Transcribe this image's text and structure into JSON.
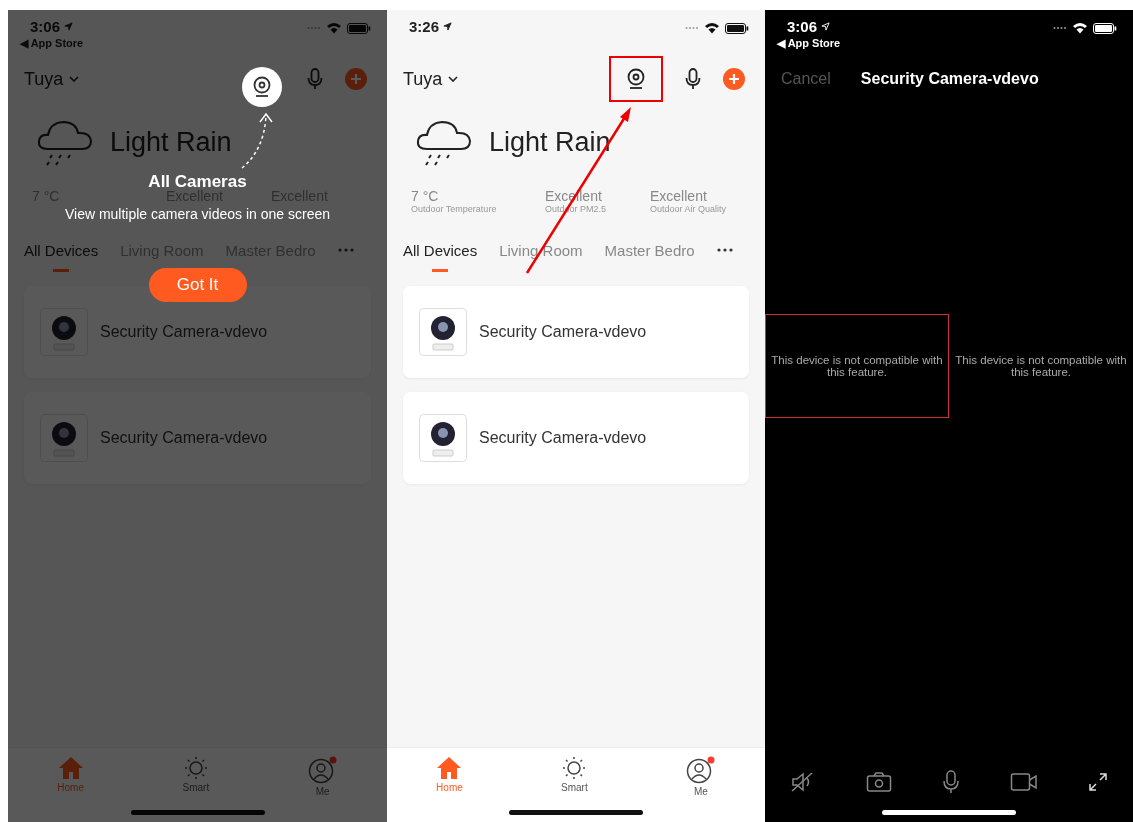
{
  "screens": [
    {
      "kind": "home",
      "dimmed": true,
      "status": {
        "time": "3:06",
        "back": "◀ App Store"
      },
      "home": "Tuya",
      "weather": "Light Rain",
      "stats": [
        {
          "value": "7 °C"
        },
        {
          "value": "Excellent"
        },
        {
          "value": "Excellent"
        }
      ],
      "tabs": [
        {
          "label": "All Devices",
          "selected": true
        },
        {
          "label": "Living Room",
          "selected": false
        },
        {
          "label": "Master Bedro",
          "selected": false
        }
      ],
      "devices": [
        {
          "name": "Security Camera-vdevo"
        },
        {
          "name": "Security Camera-vdevo"
        }
      ],
      "nav": [
        {
          "label": "Home",
          "selected": true
        },
        {
          "label": "Smart",
          "selected": false
        },
        {
          "label": "Me",
          "selected": false,
          "badge": true
        }
      ],
      "coach": {
        "title": "All Cameras",
        "text": "View multiple camera videos in one screen",
        "button": "Got It"
      }
    },
    {
      "kind": "home",
      "annotated": true,
      "status": {
        "time": "3:26"
      },
      "home": "Tuya",
      "weather": "Light Rain",
      "stats": [
        {
          "value": "7 °C",
          "label": "Outdoor Temperature"
        },
        {
          "value": "Excellent",
          "label": "Outdoor PM2.5"
        },
        {
          "value": "Excellent",
          "label": "Outdoor Air Quality"
        }
      ],
      "tabs": [
        {
          "label": "All Devices",
          "selected": true
        },
        {
          "label": "Living Room",
          "selected": false
        },
        {
          "label": "Master Bedro",
          "selected": false
        }
      ],
      "devices": [
        {
          "name": "Security Camera-vdevo"
        },
        {
          "name": "Security Camera-vdevo"
        }
      ],
      "nav": [
        {
          "label": "Home",
          "selected": true
        },
        {
          "label": "Smart",
          "selected": false
        },
        {
          "label": "Me",
          "selected": false,
          "badge": true
        }
      ]
    },
    {
      "kind": "player",
      "status": {
        "time": "3:06",
        "back": "◀ App Store"
      },
      "cancel": "Cancel",
      "title": "Security Camera-vdevo",
      "tiles": [
        {
          "message": "This device is not compatible with this feature.",
          "highlighted": true
        },
        {
          "message": "This device is not compatible with this feature.",
          "highlighted": false
        }
      ]
    }
  ]
}
